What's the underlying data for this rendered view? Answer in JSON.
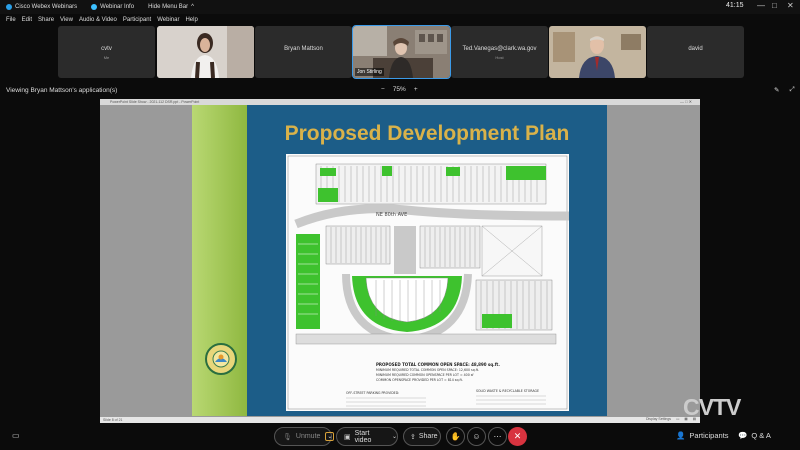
{
  "titlebar": {
    "app_title": "Cisco Webex Webinars",
    "webinar_info": "Webinar Info",
    "hide_menu_bar": "Hide Menu Bar",
    "time": "41:15"
  },
  "menu": [
    "File",
    "Edit",
    "Share",
    "View",
    "Audio & Video",
    "Participant",
    "Webinar",
    "Help"
  ],
  "participants": [
    {
      "name": "cvtv",
      "sub": "Me"
    },
    {
      "name": "",
      "sub": ""
    },
    {
      "name": "Bryan Mattson",
      "sub": ""
    },
    {
      "name": "",
      "sub": "",
      "tag": "Jon Stirling"
    },
    {
      "name": "Ted.Vanegas@clark.wa.gov",
      "sub": "Host"
    },
    {
      "name": "",
      "sub": ""
    },
    {
      "name": "david",
      "sub": ""
    }
  ],
  "share": {
    "viewing_label": "Viewing Bryan Mattson's application(s)",
    "zoom": "75%",
    "ppt_bar_text": "PowerPoint Slide Show - 2021-112 DSR.ppt - PowerPoint",
    "status_left": "Slide 8 of 21",
    "status_right": "Display Settings",
    "slide_title": "Proposed Development Plan",
    "plan_note_1": "PROPOSED TOTAL COMMON OPEN SPACE: 48,890 sq.ft.",
    "plan_note_2": "MINIMUM REQUIRED TOTAL COMMON OPEN SPACE: 12,600 sq.ft.",
    "plan_note_3": "MINIMUM REQUIRED COMMON OPENSPACE PER LOT = 400 sf",
    "plan_note_4": "COMMON OPENSPACE PROVIDED PER LOT = 814 sq.ft.",
    "plan_note_5": "SOLID WASTE & RECYCLABLE STORAGE",
    "plan_note_6": "OFF-STREET PARKING PROVIDED:",
    "plan_street": "NE 80th AVE",
    "seal_text": "CLARK COUNTY WASHINGTON"
  },
  "watermark": "CVTV",
  "controls": {
    "unmute": "Unmute",
    "start_video": "Start video",
    "share": "Share",
    "participants": "Participants",
    "qa": "Q & A"
  },
  "icons": [
    "webex-icon",
    "info-icon",
    "captions-icon",
    "mic-muted-icon",
    "video-icon",
    "share-icon",
    "raise-hand-icon",
    "reactions-icon",
    "more-icon",
    "end-call-icon",
    "participants-icon",
    "qa-icon"
  ],
  "colors": {
    "accent": "#3b9ae8",
    "end_call": "#d8333f",
    "slide_bg": "#1c5d88",
    "slide_title": "#d9b24a",
    "plan_green": "#3ec22e"
  }
}
